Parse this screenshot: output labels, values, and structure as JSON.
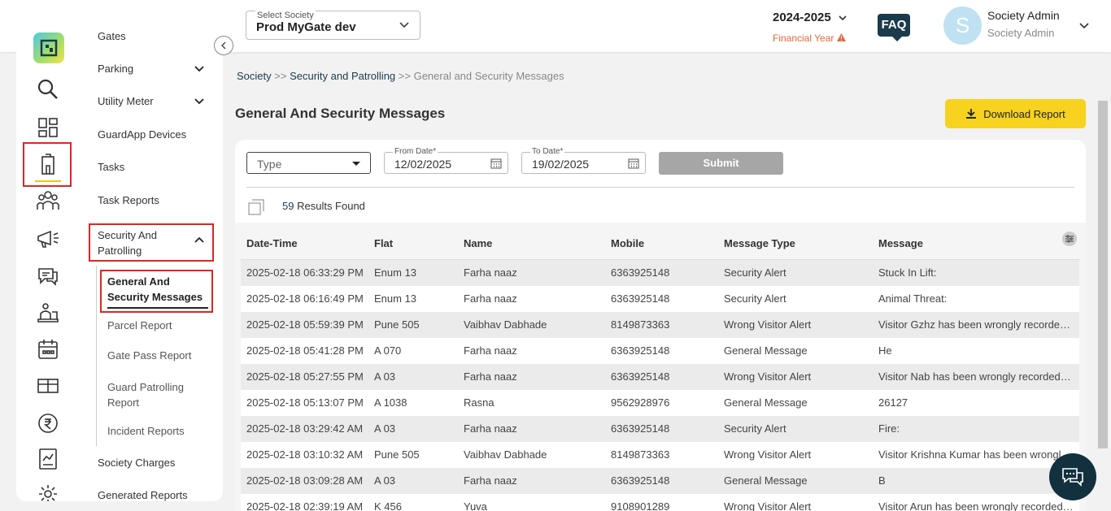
{
  "header": {
    "society_label": "Select Society",
    "society_value": "Prod MyGate dev",
    "financial_year": "2024-2025",
    "financial_year_label": "Financial Year",
    "faq": "FAQ",
    "avatar_initial": "S",
    "user_name": "Society Admin",
    "user_role": "Society Admin"
  },
  "sidebar": {
    "icons": [
      "search-icon",
      "dashboard-icon",
      "building-icon",
      "community-icon",
      "announcement-icon",
      "chat-icon",
      "helpdesk-icon",
      "calendar-icon",
      "amenities-icon",
      "rupee-icon",
      "report-icon",
      "settings-icon"
    ],
    "menu": {
      "gates": "Gates",
      "parking": "Parking",
      "utility_meter": "Utility Meter",
      "guardapp_devices": "GuardApp Devices",
      "tasks": "Tasks",
      "task_reports": "Task Reports",
      "security_line1": "Security And",
      "security_line2": "Patrolling",
      "sub_general_line1": "General And",
      "sub_general_line2": "Security Messages",
      "sub_parcel": "Parcel Report",
      "sub_gatepass": "Gate Pass Report",
      "sub_guard_line1": "Guard Patrolling",
      "sub_guard_line2": "Report",
      "sub_incident": "Incident Reports",
      "society_charges": "Society Charges",
      "generated_reports": "Generated Reports"
    }
  },
  "breadcrumb": {
    "root": "Society",
    "sep": ">>",
    "section": "Security and Patrolling",
    "current": "General and Security Messages"
  },
  "page": {
    "title": "General And Security Messages",
    "download_label": "Download Report"
  },
  "filters": {
    "type_placeholder": "Type",
    "from_label": "From Date*",
    "from_value": "12/02/2025",
    "to_label": "To Date*",
    "to_value": "19/02/2025",
    "submit": "Submit",
    "results_count": "59",
    "results_text": "Results Found"
  },
  "table": {
    "headers": [
      "Date-Time",
      "Flat",
      "Name",
      "Mobile",
      "Message Type",
      "Message"
    ],
    "rows": [
      [
        "2025-02-18 06:33:29 PM",
        "Enum 13",
        "Farha naaz",
        "6363925148",
        "Security Alert",
        "Stuck In Lift:"
      ],
      [
        "2025-02-18 06:16:49 PM",
        "Enum 13",
        "Farha naaz",
        "6363925148",
        "Security Alert",
        "Animal Threat:"
      ],
      [
        "2025-02-18 05:59:39 PM",
        "Pune 505",
        "Vaibhav Dabhade",
        "8149873363",
        "Wrong Visitor Alert",
        "Visitor Gzhz has been wrongly recorded in your flat"
      ],
      [
        "2025-02-18 05:41:28 PM",
        "A 070",
        "Farha naaz",
        "6363925148",
        "General Message",
        "He"
      ],
      [
        "2025-02-18 05:27:55 PM",
        "A 03",
        "Farha naaz",
        "6363925148",
        "Wrong Visitor Alert",
        "Visitor Nab has been wrongly recorded in your flat"
      ],
      [
        "2025-02-18 05:13:07 PM",
        "A 1038",
        "Rasna",
        "9562928976",
        "General Message",
        "26127"
      ],
      [
        "2025-02-18 03:29:42 AM",
        "A 03",
        "Farha naaz",
        "6363925148",
        "Security Alert",
        "Fire:"
      ],
      [
        "2025-02-18 03:10:32 AM",
        "Pune 505",
        "Vaibhav Dabhade",
        "8149873363",
        "Wrong Visitor Alert",
        "Visitor Krishna Kumar has been wrongly recorded"
      ],
      [
        "2025-02-18 03:09:28 AM",
        "A 03",
        "Farha naaz",
        "6363925148",
        "General Message",
        "B"
      ],
      [
        "2025-02-18 02:39:19 AM",
        "K 456",
        "Yuva",
        "9108901289",
        "Wrong Visitor Alert",
        "Visitor Arun has been wrongly recorded in your flat"
      ]
    ]
  }
}
